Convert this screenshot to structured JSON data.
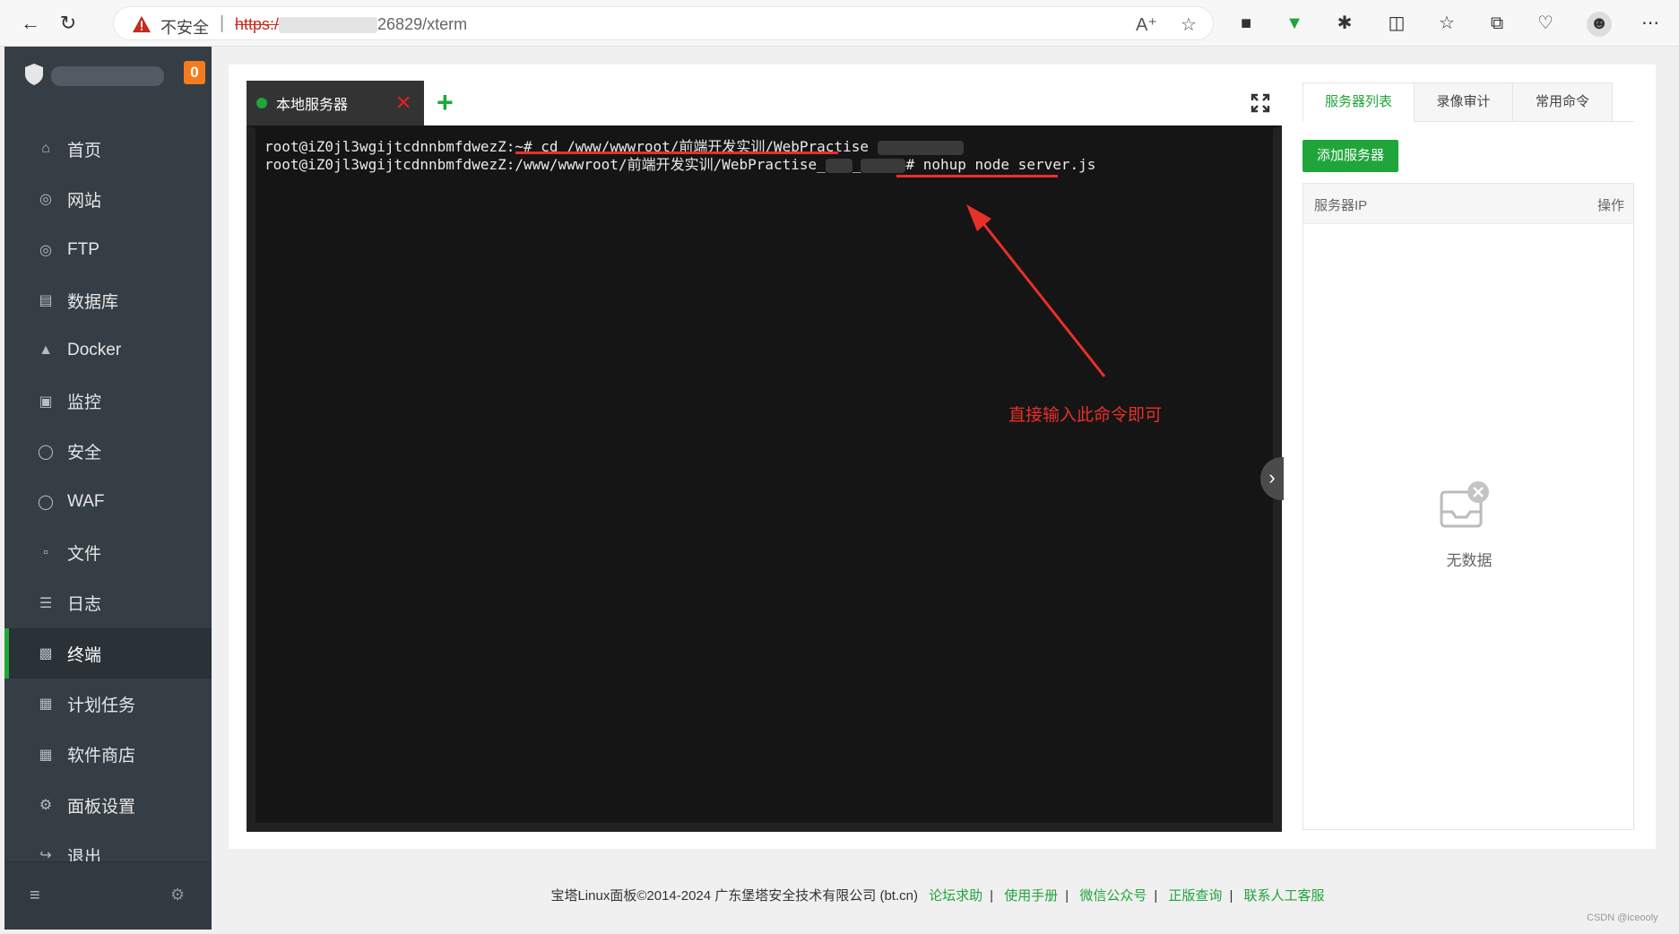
{
  "browser": {
    "insecure_label": "不安全",
    "url_scheme": "https:/",
    "url_rest": "26829/xterm"
  },
  "sidebar": {
    "badge": "0",
    "items": [
      {
        "label": "首页",
        "icon": "home-icon"
      },
      {
        "label": "网站",
        "icon": "globe-icon"
      },
      {
        "label": "FTP",
        "icon": "globe-icon"
      },
      {
        "label": "数据库",
        "icon": "database-icon"
      },
      {
        "label": "Docker",
        "icon": "docker-icon"
      },
      {
        "label": "监控",
        "icon": "monitor-icon"
      },
      {
        "label": "安全",
        "icon": "shield-icon"
      },
      {
        "label": "WAF",
        "icon": "shield-icon"
      },
      {
        "label": "文件",
        "icon": "folder-icon"
      },
      {
        "label": "日志",
        "icon": "log-icon"
      },
      {
        "label": "终端",
        "icon": "terminal-icon",
        "active": true
      },
      {
        "label": "计划任务",
        "icon": "calendar-icon"
      },
      {
        "label": "软件商店",
        "icon": "grid-icon"
      },
      {
        "label": "面板设置",
        "icon": "gear-icon"
      },
      {
        "label": "退出",
        "icon": "logout-icon"
      }
    ]
  },
  "terminal": {
    "tab_label": "本地服务器",
    "line1_prompt": "root@iZ0jl3wgijtcdnnbmfdwezZ:~# ",
    "line1_cmd": "cd /www/wwwroot/前端开发实训/WebPractise",
    "line2_prompt": "root@iZ0jl3wgijtcdnnbmfdwezZ:/www/wwwroot/前端开发实训/WebPractise_",
    "line2_mid": "_",
    "line2_hash": "# ",
    "line2_cmd": "nohup node server.js"
  },
  "annotation": {
    "text": "直接输入此命令即可",
    "color": "#e8302a"
  },
  "right_panel": {
    "tabs": [
      "服务器列表",
      "录像审计",
      "常用命令"
    ],
    "add_button": "添加服务器",
    "col_ip": "服务器IP",
    "col_action": "操作",
    "empty_text": "无数据"
  },
  "footer": {
    "copyright": "宝塔Linux面板©2014-2024 广东堡塔安全技术有限公司 (bt.cn)",
    "links": [
      "论坛求助",
      "使用手册",
      "微信公众号",
      "正版查询",
      "联系人工客服"
    ]
  },
  "watermark": "CSDN @iceooly",
  "colors": {
    "accent": "#20a53a",
    "sidebar": "#353e45",
    "badge": "#f47c1e"
  }
}
